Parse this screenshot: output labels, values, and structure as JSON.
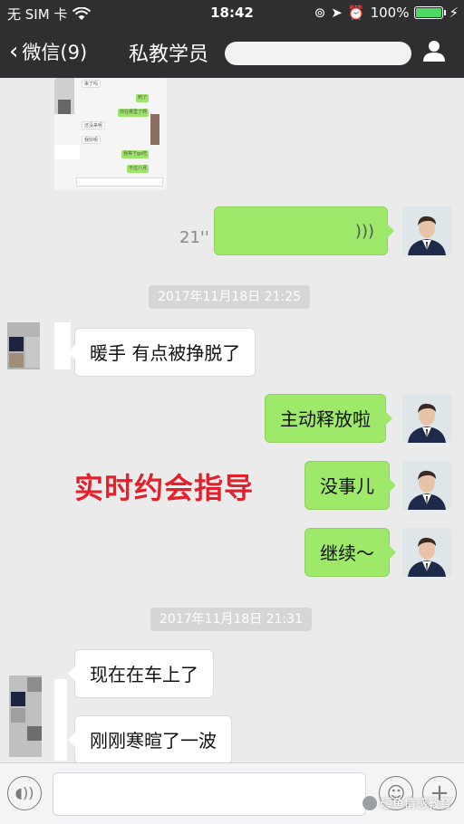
{
  "status_bar": {
    "carrier": "无 SIM 卡",
    "time": "18:42",
    "battery": "100%",
    "battery_level": 1.0
  },
  "nav": {
    "back_label": "微信(9)",
    "title": "私教学员"
  },
  "messages": {
    "voice_duration": "21''",
    "timestamp_1": "2017年11月18日 21:25",
    "msg_warm_hands": "暖手 有点被挣脱了",
    "msg_take_initiative": "主动释放啦",
    "msg_no_problem": "没事儿",
    "msg_continue": "继续～",
    "timestamp_2": "2017年11月18日 21:31",
    "msg_in_car": "现在在车上了",
    "msg_greeted": "刚刚寒暄了一波"
  },
  "overlay": {
    "caption": "实时约会指导"
  },
  "thumbnail": {
    "lines": [
      "来了吗",
      "到了",
      "你在哪里了啊",
      "还没来呢",
      "我好呢",
      "我等下go吃",
      "不过八月"
    ]
  },
  "watermark": {
    "text": "暖鱼情感教育"
  },
  "colors": {
    "nav_bg": "#2f2f31",
    "chat_bg": "#ebebeb",
    "bubble_green": "#9ee86a",
    "bubble_white": "#ffffff",
    "caption_red": "#e5202a"
  }
}
